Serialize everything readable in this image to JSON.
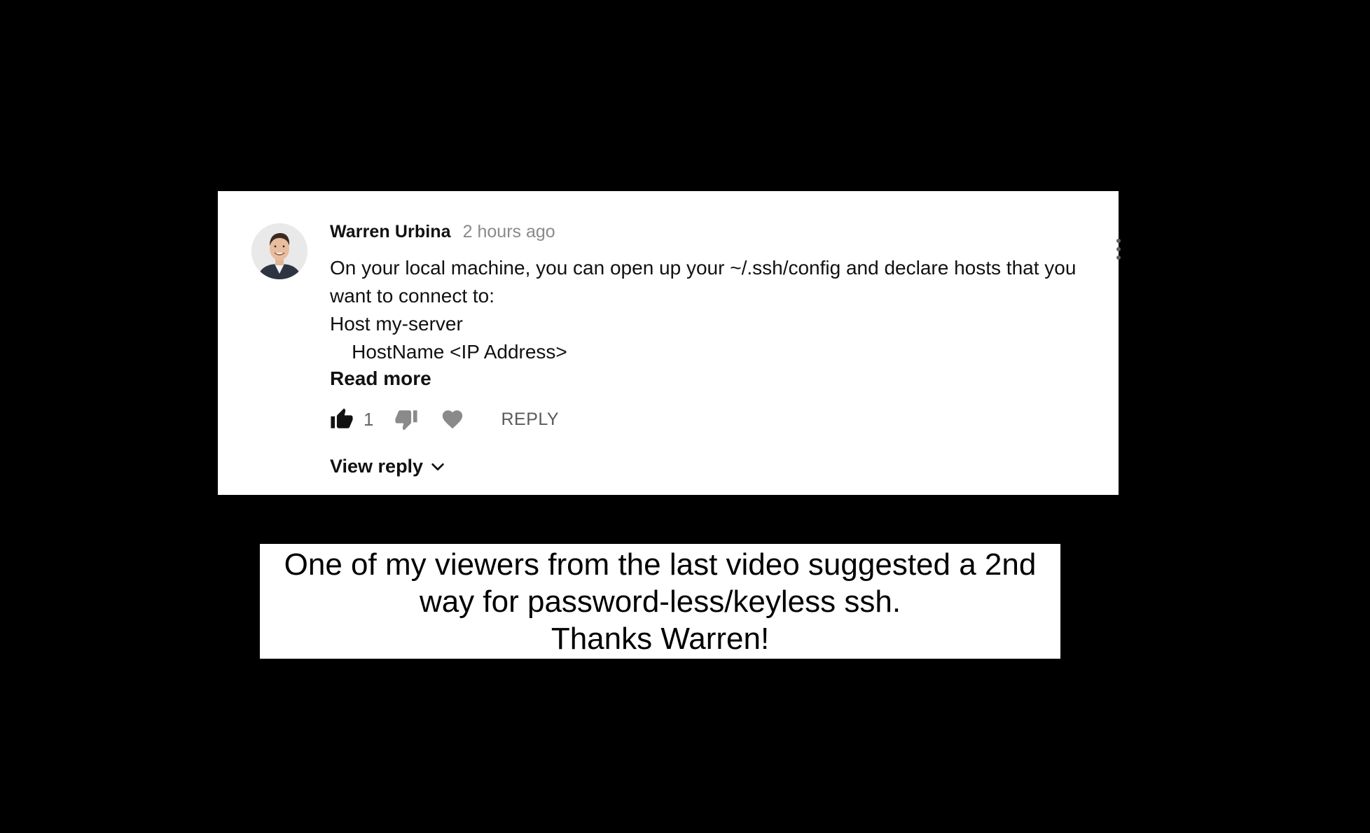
{
  "comment": {
    "author": "Warren Urbina",
    "timestamp": "2 hours ago",
    "lines": [
      "On your local machine, you can open up your ~/.ssh/config and declare hosts that you",
      "want to connect to:",
      "Host my-server",
      "    HostName <IP Address>"
    ],
    "read_more_label": "Read more",
    "like_count": "1",
    "reply_label": "REPLY",
    "view_reply_label": "View reply",
    "icons": {
      "like": "thumbs-up-icon",
      "dislike": "thumbs-down-icon",
      "heart": "heart-icon",
      "more": "more-vert-icon",
      "chevron": "chevron-down-icon"
    }
  },
  "caption": {
    "lines": [
      "One of my viewers from the last video suggested a 2nd",
      "way for password-less/keyless ssh.",
      "Thanks Warren!"
    ]
  },
  "colors": {
    "background": "#000000",
    "card": "#ffffff",
    "text": "#111111",
    "muted": "#8a8a8a",
    "icon": "#606060"
  }
}
